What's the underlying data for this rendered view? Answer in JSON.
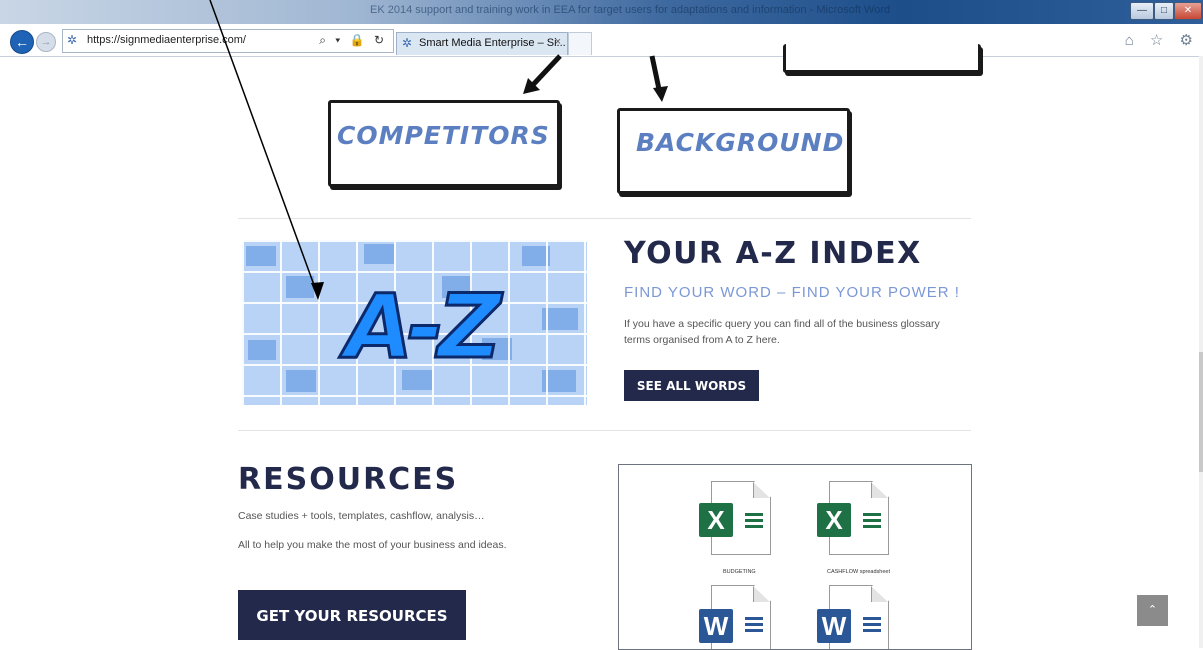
{
  "window": {
    "title": "EK 2014 support and training work in EEA for target users for adaptations and information - Microsoft Word",
    "minimize": "—",
    "maximize": "□",
    "close": "✕"
  },
  "browser": {
    "url": "https://signmediaenterprise.com/",
    "tab_title": "Smart Media Enterprise – Si...",
    "tab_close": "×",
    "url_tools": "⌕ ▾ 🔒 ↻",
    "toolbar_icons": "⌂ ☆ ⚙"
  },
  "page": {
    "sketch": {
      "competitors": "COMPETITORS",
      "background": "BACKGROUND"
    },
    "az": {
      "title": "YOUR A-Z INDEX",
      "subtitle": "FIND YOUR WORD – FIND YOUR POWER !",
      "text": "If you have a specific query you can find all of the business glossary terms organised from A to Z here.",
      "button": "SEE ALL WORDS",
      "image_text": "A-Z"
    },
    "resources": {
      "title": "RESOURCES",
      "text1": "Case studies + tools, templates, cashflow, analysis…",
      "text2": "All to help you make the most of your business and ideas.",
      "button": "GET YOUR RESOURCES",
      "files": [
        {
          "label": "BUDGETING",
          "type": "X"
        },
        {
          "label": "CASHFLOW spreadsheet",
          "type": "X"
        },
        {
          "label": "",
          "type": "W"
        },
        {
          "label": "",
          "type": "W"
        }
      ]
    },
    "scroll_top": "⌃"
  },
  "colors": {
    "heading": "#23294a",
    "accent": "#7b98d6",
    "excel": "#1e7145",
    "word": "#2b5797"
  }
}
